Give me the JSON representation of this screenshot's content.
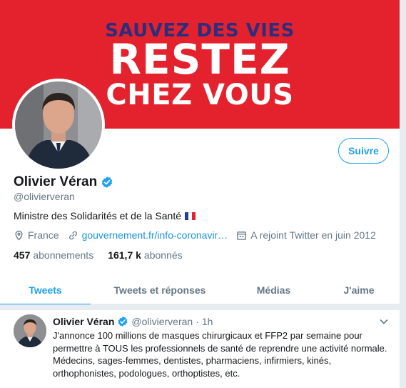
{
  "banner": {
    "line1": "SAUVEZ DES VIES",
    "line2": "RESTEZ",
    "line3": "CHEZ VOUS"
  },
  "profile": {
    "follow_label": "Suivre",
    "name": "Olivier Véran",
    "handle": "@olivierveran",
    "bio": "Ministre des Solidarités et de la Santé",
    "location": "France",
    "website": "gouvernement.fr/info-coronavir…",
    "joined": "A rejoint Twitter en juin 2012",
    "following_count": "457",
    "following_label": "abonnements",
    "followers_count": "161,7 k",
    "followers_label": "abonnés"
  },
  "tabs": [
    {
      "label": "Tweets",
      "active": true
    },
    {
      "label": "Tweets et réponses",
      "active": false
    },
    {
      "label": "Médias",
      "active": false
    },
    {
      "label": "J'aime",
      "active": false
    }
  ],
  "tweet": {
    "name": "Olivier Véran",
    "handle": "@olivierveran",
    "separator": "·",
    "time": "1h",
    "text": "J'annonce 100 millions de masques chirurgicaux et FFP2 par semaine pour permettre à TOUS les professionnels de santé de reprendre une activité normale. Médecins, sages-femmes, dentistes, pharmaciens, infirmiers, kinés, orthophonistes, podologues, orthoptistes, etc."
  },
  "colors": {
    "banner_red": "#e4222e",
    "banner_navy": "#2b2d7d",
    "accent_blue": "#1da1f2",
    "link_blue": "#1b95e0",
    "muted": "#657786"
  },
  "icons": [
    "verified-badge-icon",
    "france-flag-icon",
    "location-pin-icon",
    "link-icon",
    "calendar-icon",
    "chevron-down-icon"
  ]
}
